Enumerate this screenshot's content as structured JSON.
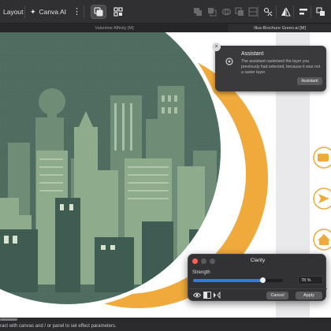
{
  "toolbar": {
    "layout_label": "Layout",
    "canva_ai_label": "Canva AI",
    "more_icon": "more-vertical-icon",
    "icons": [
      "layer-mode-icon",
      "grid-snap-icon",
      "boolean-add-icon",
      "boolean-subtract-icon",
      "boolean-intersect-icon",
      "boolean-xor-icon",
      "boolean-divide-icon",
      "node-edit-icon",
      "flip-icon",
      "align-left-icon",
      "arrange-icon"
    ]
  },
  "tabs": {
    "left": "Valentine Affinity [M]",
    "right": "Illus-Brochure Green.ai [M]"
  },
  "assistant": {
    "title": "Assistant",
    "message": "The assistant rasterised the layer you previously had selected, because it was not a raster layer.",
    "button": "Assistant",
    "icon": "assistant-gear-icon"
  },
  "dialog": {
    "title": "Clarity",
    "strength_label": "Strength",
    "strength_value": "78 %",
    "strength_fraction": 0.78,
    "cancel": "Cancel",
    "apply": "Apply"
  },
  "sidebar_icons": [
    "phone-icon",
    "send-icon",
    "home-icon"
  ],
  "status": {
    "text": "ract with canvas and / or panel to set effect parameters."
  },
  "colors": {
    "accent": "#2f7de1",
    "orange_arc": "#f0aa3c",
    "city_bg": "#49665b"
  }
}
